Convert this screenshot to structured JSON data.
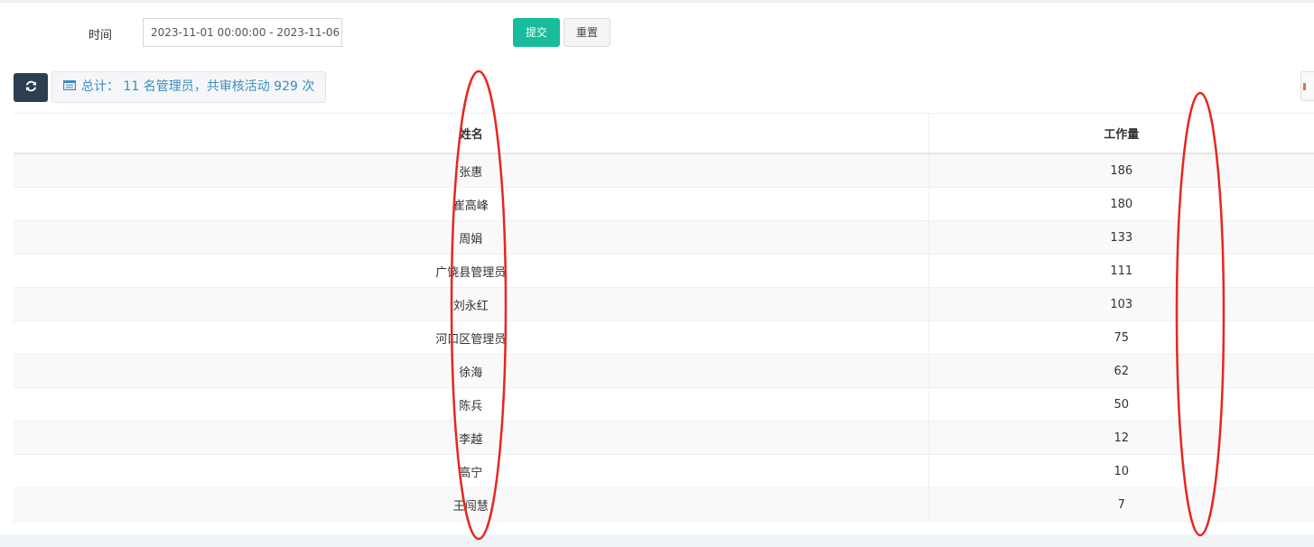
{
  "filter": {
    "time_label": "时间",
    "time_value": "2023-11-01 00:00:00 - 2023-11-06",
    "submit_label": "提交",
    "reset_label": "重置"
  },
  "toolbar": {
    "refresh_icon": "refresh-icon",
    "total_text": "总计： 11 名管理员，共审核活动 929 次",
    "accent_color": "#3c8dbc"
  },
  "table": {
    "headers": [
      "姓名",
      "工作量"
    ],
    "rows": [
      {
        "name": "张惠",
        "workload": "186"
      },
      {
        "name": "崔高峰",
        "workload": "180"
      },
      {
        "name": "周娟",
        "workload": "133"
      },
      {
        "name": "广饶县管理员",
        "workload": "111"
      },
      {
        "name": "刘永红",
        "workload": "103"
      },
      {
        "name": "河口区管理员",
        "workload": "75"
      },
      {
        "name": "徐海",
        "workload": "62"
      },
      {
        "name": "陈兵",
        "workload": "50"
      },
      {
        "name": "李越",
        "workload": "12"
      },
      {
        "name": "高宁",
        "workload": "10"
      },
      {
        "name": "王闯慧",
        "workload": "7"
      }
    ]
  },
  "colors": {
    "submit_button": "#18bc9c",
    "refresh_button": "#2c3e50",
    "annotation_ellipse": "#e8261e"
  }
}
